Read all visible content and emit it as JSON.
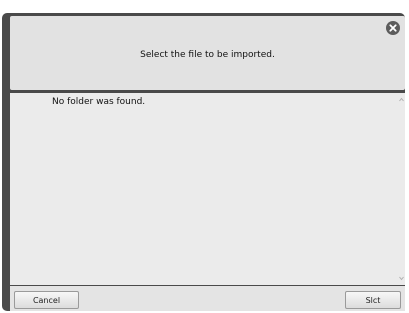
{
  "dialog": {
    "title": "Select the file to be imported.",
    "close_icon": "close-icon",
    "empty_message": "No folder was found.",
    "buttons": {
      "cancel": "Cancel",
      "select": "Slct"
    }
  },
  "colors": {
    "frame": "#4a4a4a",
    "header_bg": "#e2e2e2",
    "content_bg": "#ebebeb",
    "footer_bg": "#e4e4e4"
  }
}
